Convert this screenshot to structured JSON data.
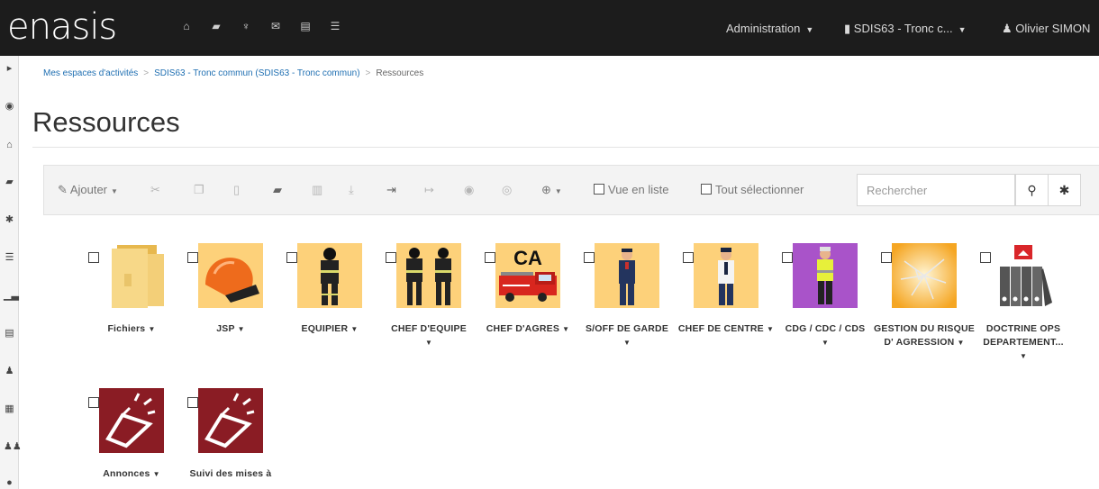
{
  "app": {
    "brand": "enasis"
  },
  "navbar": {
    "icons": [
      "home-icon",
      "folder-icon",
      "trophy-icon",
      "envelope-icon",
      "newspaper-icon",
      "list-icon"
    ],
    "administration": "Administration",
    "workspace": "SDIS63 - Tronc c...",
    "user": "Olivier SIMON"
  },
  "sidebar": {
    "icons": [
      "caret-right-icon",
      "eye-icon",
      "home-icon",
      "folder-icon",
      "gear-icon",
      "list-icon",
      "bar-chart-icon",
      "newspaper-icon",
      "user-icon",
      "calendar-icon",
      "group-icon",
      "chat-icon"
    ]
  },
  "breadcrumb": {
    "items": [
      "Mes espaces d'activités",
      "SDIS63 - Tronc commun (SDIS63 - Tronc commun)",
      "Ressources"
    ]
  },
  "page": {
    "title": "Ressources"
  },
  "toolbar": {
    "add_label": "Ajouter",
    "list_view_label": "Vue en liste",
    "select_all_label": "Tout sélectionner",
    "search_placeholder": "Rechercher",
    "icons": [
      "cut-icon",
      "copy-icon",
      "paste-icon",
      "folder-move-icon",
      "trash-icon",
      "download-icon",
      "sign-in-icon",
      "sign-out-icon",
      "eye-icon",
      "eye-slash-icon",
      "zoom-icon"
    ]
  },
  "tiles": [
    {
      "label": "Fichiers",
      "caret": true,
      "image": "folder-image"
    },
    {
      "label": "JSP",
      "caret": true,
      "image": "helmet-image"
    },
    {
      "label": "EQUIPIER",
      "caret": true,
      "image": "firefighter-image"
    },
    {
      "label": "CHEF D'EQUIPE",
      "caret": true,
      "image": "two-firefighters-image"
    },
    {
      "label": "CHEF D'AGRES",
      "caret": true,
      "image": "fire-truck-image",
      "badge": "CA"
    },
    {
      "label": "S/OFF DE GARDE",
      "caret": true,
      "image": "officer-image"
    },
    {
      "label": "CHEF DE CENTRE",
      "caret": true,
      "image": "chief-image"
    },
    {
      "label": "CDG / CDC / CDS",
      "caret": true,
      "image": "vest-image"
    },
    {
      "label": "GESTION DU RISQUE D' AGRESSION",
      "caret": true,
      "image": "shatter-image"
    },
    {
      "label": "DOCTRINE OPS DEPARTEMENT...",
      "caret": true,
      "image": "binders-image"
    },
    {
      "label": "Annonces",
      "caret": true,
      "image": "megaphone-image"
    },
    {
      "label": "Suivi des mises à",
      "caret": false,
      "image": "megaphone-image"
    }
  ],
  "colors": {
    "navbar_bg": "#1c1c1c",
    "tile_yellow": "#fdd17a",
    "tile_orange": "#f5a623",
    "tile_purple": "#a953c9",
    "tile_maroon": "#8a1c24",
    "link": "#1f6fb2"
  }
}
